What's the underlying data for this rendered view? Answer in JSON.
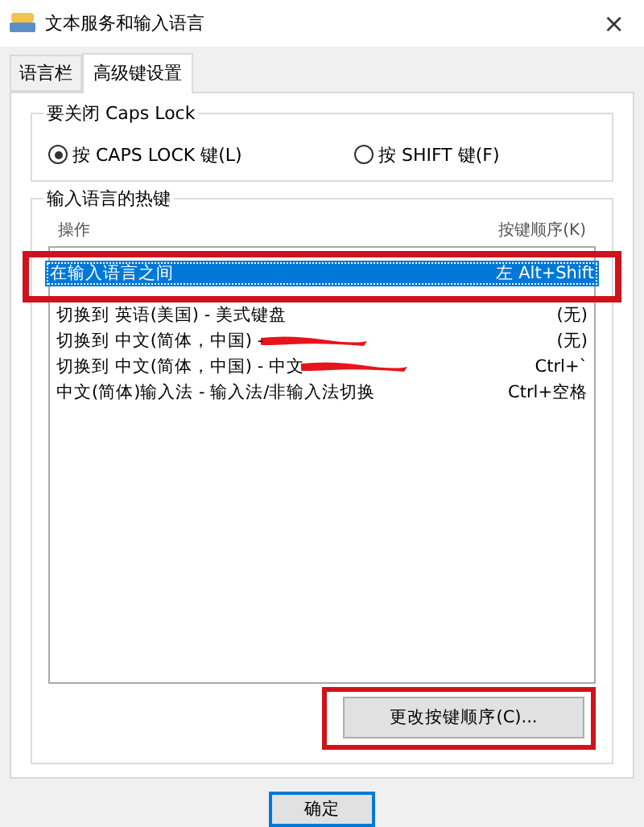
{
  "window": {
    "title": "文本服务和输入语言",
    "close": "×"
  },
  "tabs": [
    {
      "label": "语言栏",
      "selected": false
    },
    {
      "label": "高级键设置",
      "selected": true
    }
  ],
  "caps_lock": {
    "title": "要关闭 Caps Lock",
    "options": [
      {
        "label": "按 CAPS LOCK 键(L)",
        "selected": true
      },
      {
        "label": "按 SHIFT 键(F)",
        "selected": false
      }
    ]
  },
  "hotkeys": {
    "title": "输入语言的热键",
    "columns": [
      "操作",
      "按键顺序(K)"
    ],
    "rows": [
      {
        "action": "在输入语言之间",
        "keys": "左 Alt+Shift",
        "selected": true,
        "redacted": false
      },
      {
        "action": "切换到 英语(美国) - 美式键盘",
        "keys": "(无)",
        "selected": false,
        "redacted": false
      },
      {
        "action": "切换到 中文(简体，中国) -",
        "keys": "(无)",
        "selected": false,
        "redacted": true
      },
      {
        "action": "切换到 中文(简体，中国) - 中文",
        "keys": "Ctrl+`",
        "selected": false,
        "redacted": true
      },
      {
        "action": "中文(简体)输入法 - 输入法/非输入法切换",
        "keys": "Ctrl+空格",
        "selected": false,
        "redacted": false
      }
    ],
    "button": "更改按键顺序(C)..."
  },
  "buttons": [
    "确定"
  ]
}
